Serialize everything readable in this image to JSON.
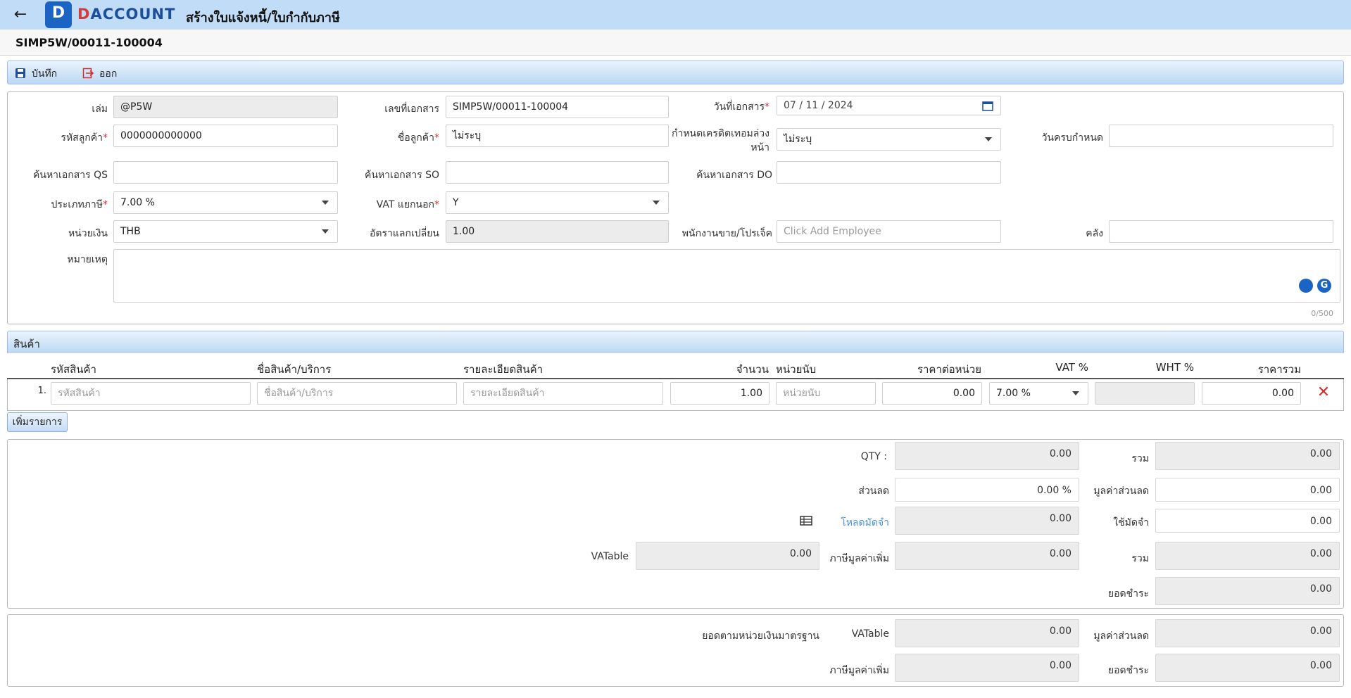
{
  "header": {
    "logo_letter": "D",
    "brand_prefix": "D",
    "brand_rest": "ACCOUNT",
    "page_title": "สร้างใบแจ้งหนี้/ใบกำกับภาษี",
    "doc_id": "SIMP5W/00011-100004"
  },
  "toolbar": {
    "save_label": "บันทึก",
    "exit_label": "ออก"
  },
  "form": {
    "book_label": "เล่ม",
    "book_value": "@P5W",
    "docno_label": "เลขที่เอกสาร",
    "docno_value": "SIMP5W/00011-100004",
    "docdate_label": "วันที่เอกสาร",
    "docdate_day": "07",
    "docdate_month": "11",
    "docdate_year": "2024",
    "custcode_label": "รหัสลูกค้า",
    "custcode_value": "0000000000000",
    "custname_label": "ชื่อลูกค้า",
    "custname_value": "ไม่ระบุ",
    "credit_label_1": "กำหนดเครดิตเทอมล่วง",
    "credit_label_2": "หน้า",
    "credit_value": "ไม่ระบุ",
    "duedate_label": "วันครบกำหนด",
    "duedate_value": "",
    "qs_label": "ค้นหาเอกสาร QS",
    "so_label": "ค้นหาเอกสาร SO",
    "do_label": "ค้นหาเอกสาร DO",
    "taxtype_label": "ประเภทภาษี",
    "taxtype_value": "7.00 %",
    "vat_label": "VAT แยกนอก",
    "vat_value": "Y",
    "currency_label": "หน่วยเงิน",
    "currency_value": "THB",
    "rate_label": "อัตราแลกเปลี่ยน",
    "rate_value": "1.00",
    "employee_label": "พนักงานขาย/โปรเจ็ค",
    "employee_placeholder": "Click Add Employee",
    "warehouse_label": "คลัง",
    "warehouse_value": "",
    "remark_label": "หมายเหตุ",
    "remark_counter": "0/500",
    "required_mark": "*"
  },
  "products": {
    "section_title": "สินค้า",
    "columns": [
      "รหัสสินค้า",
      "ชื่อสินค้า/บริการ",
      "รายละเอียดสินค้า",
      "จำนวน",
      "หน่วยนับ",
      "ราคาต่อหน่วย",
      "VAT %",
      "WHT %",
      "ราคารวม"
    ],
    "rows": [
      {
        "index": "1.",
        "code_ph": "รหัสสินค้า",
        "name_ph": "ชื่อสินค้า/บริการ",
        "detail_ph": "รายละเอียดสินค้า",
        "qty": "1.00",
        "unit_ph": "หน่วยนับ",
        "price": "0.00",
        "vat": "7.00 %",
        "wht": "",
        "total": "0.00"
      }
    ],
    "add_label": "เพิ่มรายการ"
  },
  "summary": {
    "qty_label": "QTY :",
    "qty_value": "0.00",
    "sum_label": "รวม",
    "sum_value": "0.00",
    "discount_label": "ส่วนลด",
    "discount_value": "0.00 %",
    "discount_amount_label": "มูลค่าส่วนลด",
    "discount_amount_value": "0.00",
    "deposit_load_label": "โหลดมัดจำ",
    "deposit_load_value": "0.00",
    "deposit_use_label": "ใช้มัดจำ",
    "deposit_use_value": "0.00",
    "vatable_label": "VATable",
    "vatable_value": "0.00",
    "vat_label": "ภาษีมูลค่าเพิ่ม",
    "vat_value": "0.00",
    "total_label": "รวม",
    "total_value": "0.00",
    "payment_label": "ยอดชำระ",
    "payment_value": "0.00"
  },
  "standard": {
    "section_label": "ยอดตามหน่วยเงินมาตรฐาน",
    "vatable_label": "VATable",
    "vatable_value": "0.00",
    "discount_amount_label": "มูลค่าส่วนลด",
    "discount_amount_value": "0.00",
    "vat_label": "ภาษีมูลค่าเพิ่ม",
    "vat_value": "0.00",
    "payment_label": "ยอดชำระ",
    "payment_value": "0.00"
  },
  "colors": {
    "header_bg": "#c0dcf7",
    "accent": "#1b64c4",
    "danger": "#d32f2f",
    "link": "#4a8fd8"
  }
}
